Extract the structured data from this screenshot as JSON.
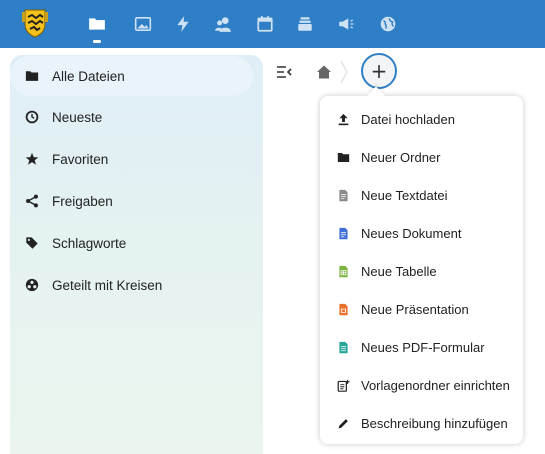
{
  "header": {
    "logo": "coat-of-arms-logo",
    "apps": [
      {
        "name": "files",
        "icon": "folder-icon"
      },
      {
        "name": "photos",
        "icon": "image-icon"
      },
      {
        "name": "activity",
        "icon": "lightning-icon"
      },
      {
        "name": "contacts",
        "icon": "contacts-icon"
      },
      {
        "name": "calendar",
        "icon": "calendar-icon"
      },
      {
        "name": "deck",
        "icon": "stack-icon"
      },
      {
        "name": "announcements",
        "icon": "megaphone-icon"
      },
      {
        "name": "circles",
        "icon": "globe-icon"
      }
    ],
    "accent": "#2f7fc6"
  },
  "sidebar": {
    "items": [
      {
        "label": "Alle Dateien",
        "icon": "folder-icon",
        "active": true
      },
      {
        "label": "Neueste",
        "icon": "clock-icon"
      },
      {
        "label": "Favoriten",
        "icon": "star-icon"
      },
      {
        "label": "Freigaben",
        "icon": "share-icon"
      },
      {
        "label": "Schlagworte",
        "icon": "tag-icon"
      },
      {
        "label": "Geteilt mit Kreisen",
        "icon": "circles-icon"
      }
    ]
  },
  "toolbar": {
    "add_label": "+"
  },
  "new_menu": {
    "items": [
      {
        "label": "Datei hochladen",
        "icon": "upload-icon"
      },
      {
        "label": "Neuer Ordner",
        "icon": "folder-icon"
      },
      {
        "label": "Neue Textdatei",
        "icon": "text-file-icon"
      },
      {
        "label": "Neues Dokument",
        "icon": "document-icon"
      },
      {
        "label": "Neue Tabelle",
        "icon": "spreadsheet-icon"
      },
      {
        "label": "Neue Präsentation",
        "icon": "presentation-icon"
      },
      {
        "label": "Neues PDF-Formular",
        "icon": "pdf-form-icon"
      },
      {
        "label": "Vorlagenordner einrichten",
        "icon": "template-folder-icon"
      },
      {
        "label": "Beschreibung hinzufügen",
        "icon": "pencil-icon"
      }
    ]
  }
}
